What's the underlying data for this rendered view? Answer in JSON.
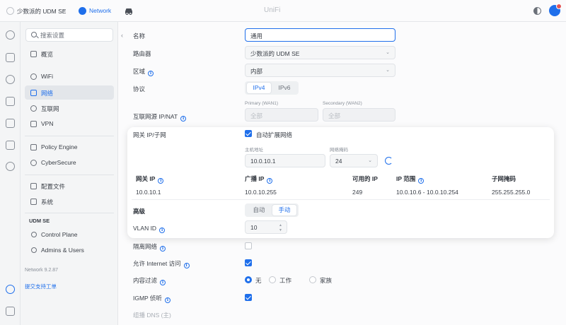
{
  "topbar": {
    "site_name": "少数派的 UDM SE",
    "app_name": "Network",
    "title": "UniFi",
    "site_chevron": "⌄"
  },
  "sidebar": {
    "search_placeholder": "搜索设置",
    "items": [
      {
        "label": "概览"
      },
      {
        "label": "WiFi"
      },
      {
        "label": "网络",
        "active": true
      },
      {
        "label": "互联网"
      },
      {
        "label": "VPN"
      },
      {
        "label": "Policy Engine"
      },
      {
        "label": "CyberSecure"
      },
      {
        "label": "配置文件"
      },
      {
        "label": "系统"
      }
    ],
    "device_section": "UDM SE",
    "device_items": [
      {
        "label": "Control Plane"
      },
      {
        "label": "Admins & Users"
      }
    ],
    "version": "Network 9.2.87",
    "support_link": "提交支持工单",
    "collapse": "‹"
  },
  "form": {
    "name_label": "名称",
    "name_value": "通用",
    "router_label": "路由器",
    "router_value": "少数派的 UDM SE",
    "zone_label": "区域",
    "zone_value": "内部",
    "protocol_label": "协议",
    "protocol_options": [
      "IPv4",
      "IPv6"
    ],
    "protocol_selected": "IPv4",
    "nat_label": "互联网源 IP/NAT",
    "primary_wan_label": "Primary (WAN1)",
    "secondary_wan_label": "Secondary (WAN2)",
    "primary_wan_value": "全部",
    "secondary_wan_value": "全部",
    "isolate_label": "隔离网络",
    "isolate_checked": false,
    "internet_access_label": "允许 Internet 访问",
    "internet_access_checked": true,
    "content_filter_label": "内容过滤",
    "content_filter_options": [
      "无",
      "工作",
      "家族"
    ],
    "content_filter_selected": "无",
    "igmp_label": "IGMP 侦听",
    "igmp_checked": true,
    "faded_label": "组播 DNS (主)"
  },
  "card": {
    "gateway_subnet_label": "网关 IP/子网",
    "auto_scale_label": "自动扩展网络",
    "auto_scale_checked": true,
    "host_address_label": "主机地址",
    "host_address_value": "10.0.10.1",
    "netmask_label": "网络掩码",
    "netmask_value": "24",
    "table_headers": [
      "网关 IP",
      "广播 IP",
      "可用的 IP",
      "IP 范围",
      "子网掩码"
    ],
    "table_row": [
      "10.0.10.1",
      "10.0.10.255",
      "249",
      "10.0.10.6 - 10.0.10.254",
      "255.255.255.0"
    ],
    "advanced_label": "高级",
    "advanced_options": [
      "自动",
      "手动"
    ],
    "advanced_selected": "手动",
    "vlan_label": "VLAN ID",
    "vlan_value": "10"
  },
  "icons": {
    "info_glyph": "i",
    "chevron_glyph": "⌄",
    "stepper_up": "▲",
    "stepper_down": "▼"
  },
  "colors": {
    "accent": "#1f6feb",
    "background": "#f4f5f6",
    "card": "#ffffff"
  }
}
